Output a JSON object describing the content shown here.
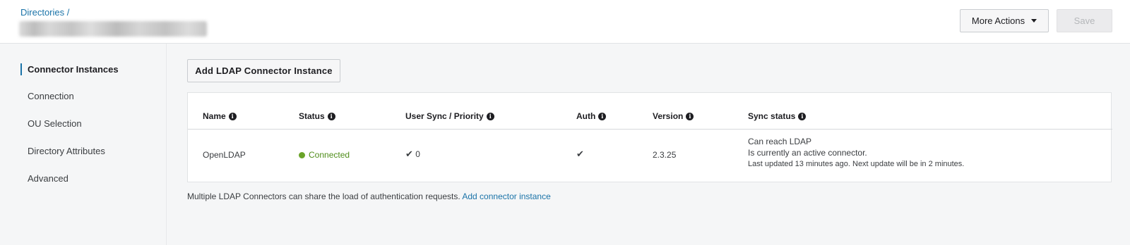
{
  "header": {
    "breadcrumb": "Directories /",
    "more_actions_label": "More Actions",
    "save_label": "Save"
  },
  "sidebar": {
    "items": [
      {
        "label": "Connector Instances",
        "active": true
      },
      {
        "label": "Connection",
        "active": false
      },
      {
        "label": "OU Selection",
        "active": false
      },
      {
        "label": "Directory Attributes",
        "active": false
      },
      {
        "label": "Advanced",
        "active": false
      }
    ]
  },
  "main": {
    "add_button_label": "Add LDAP Connector Instance",
    "table": {
      "columns": [
        "Name",
        "Status",
        "User Sync / Priority",
        "Auth",
        "Version",
        "Sync status"
      ],
      "rows": [
        {
          "name": "OpenLDAP",
          "status": "Connected",
          "user_sync_priority": "0",
          "version": "2.3.25",
          "sync_status_line1": "Can reach LDAP",
          "sync_status_line2": "Is currently an active connector.",
          "sync_status_line3": "Last updated 13 minutes ago. Next update will be in 2 minutes."
        }
      ]
    },
    "footer_text": "Multiple LDAP Connectors can share the load of authentication requests.",
    "footer_link": "Add connector instance"
  },
  "icons": {
    "info": "info-icon",
    "check": "check-icon",
    "caret": "caret-down-icon"
  },
  "colors": {
    "accent": "#1a73a8",
    "status_ok": "#6aa329"
  }
}
